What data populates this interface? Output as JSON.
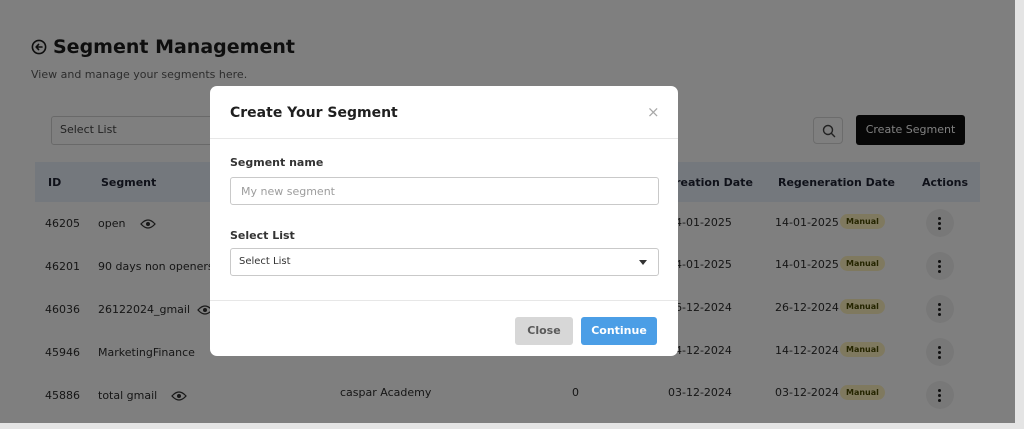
{
  "header": {
    "title": "Segment Management",
    "subtitle": "View and manage your segments here."
  },
  "toolbar": {
    "select_list_placeholder": "Select List",
    "create_label": "Create Segment"
  },
  "table": {
    "columns": {
      "id": "ID",
      "segment": "Segment",
      "creation": "Creation Date",
      "regeneration": "Regeneration Date",
      "actions": "Actions"
    },
    "rows": [
      {
        "id": "46205",
        "segment": "open",
        "list": "",
        "count": "",
        "creation": "14-01-2025",
        "regeneration": "14-01-2025",
        "badge": "Manual"
      },
      {
        "id": "46201",
        "segment": "90 days non openers",
        "list": "",
        "count": "",
        "creation": "14-01-2025",
        "regeneration": "14-01-2025",
        "badge": "Manual"
      },
      {
        "id": "46036",
        "segment": "26122024_gmail",
        "list": "",
        "count": "",
        "creation": "26-12-2024",
        "regeneration": "26-12-2024",
        "badge": "Manual"
      },
      {
        "id": "45946",
        "segment": "MarketingFinance",
        "list": "",
        "count": "",
        "creation": "14-12-2024",
        "regeneration": "14-12-2024",
        "badge": "Manual"
      },
      {
        "id": "45886",
        "segment": "total gmail",
        "list": "caspar Academy",
        "count": "0",
        "creation": "03-12-2024",
        "regeneration": "03-12-2024",
        "badge": "Manual"
      }
    ]
  },
  "modal": {
    "title": "Create Your Segment",
    "close_icon": "×",
    "name_label": "Segment name",
    "name_placeholder": "My new segment",
    "list_label": "Select List",
    "list_value": "Select List",
    "close_label": "Close",
    "continue_label": "Continue"
  },
  "icons": {
    "back": "circle-arrow-left-icon",
    "search": "search-icon",
    "eye": "eye-icon",
    "kebab": "kebab-menu-icon",
    "caret": "caret-down-icon"
  },
  "colors": {
    "primary_button": "#4b9ee6",
    "create_button": "#0f0f0f",
    "table_header": "#e9f1fb",
    "manual_badge": "#fff3bf"
  }
}
